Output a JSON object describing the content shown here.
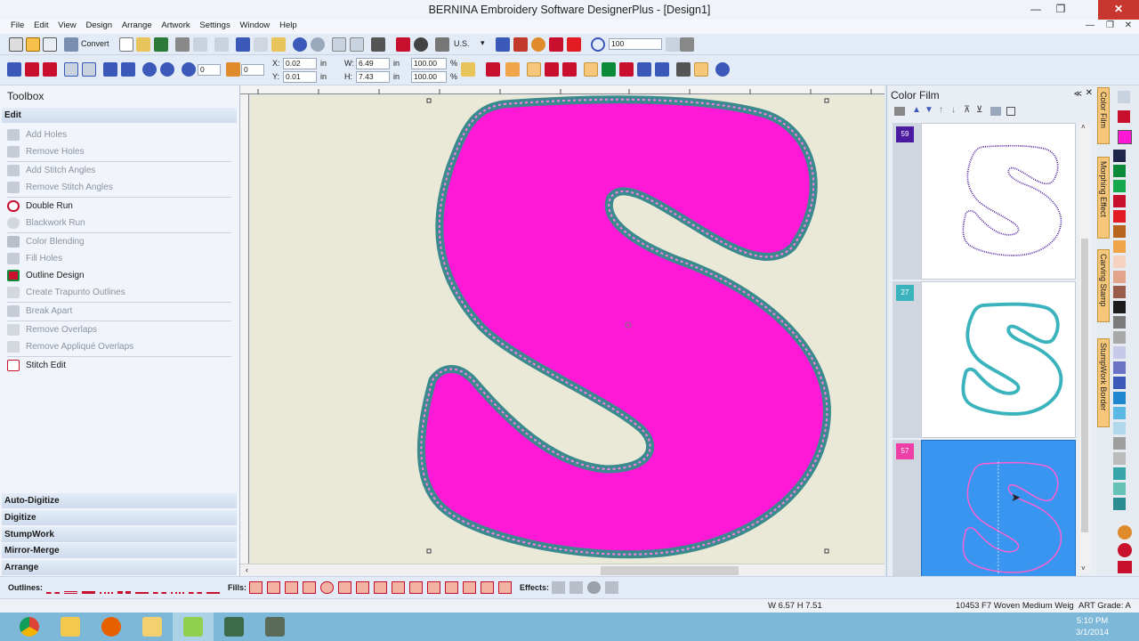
{
  "window": {
    "title": "BERNINA Embroidery Software DesignerPlus - [Design1]"
  },
  "menu": [
    "File",
    "Edit",
    "View",
    "Design",
    "Arrange",
    "Artwork",
    "Settings",
    "Window",
    "Help"
  ],
  "toolbar1": {
    "convert_label": "Convert",
    "units_value": "U.S.",
    "zoom_value": "100"
  },
  "toolbar2": {
    "rotate_value": "0",
    "slant_value": "0",
    "x_label": "X:",
    "x_value": "0.02",
    "y_label": "Y:",
    "y_value": "0.01",
    "w_label": "W:",
    "w_value": "6.49",
    "h_label": "H:",
    "h_value": "7.43",
    "unit": "in",
    "w_pct": "100.00",
    "h_pct": "100.00",
    "pct": "%"
  },
  "toolbox": {
    "title": "Toolbox",
    "edit_header": "Edit",
    "items": [
      {
        "label": "Add Holes",
        "enabled": false
      },
      {
        "label": "Remove Holes",
        "enabled": false
      },
      {
        "label": "Add Stitch Angles",
        "enabled": false
      },
      {
        "label": "Remove Stitch Angles",
        "enabled": false
      },
      {
        "label": "Double Run",
        "enabled": true
      },
      {
        "label": "Blackwork Run",
        "enabled": false
      },
      {
        "label": "Color Blending",
        "enabled": false
      },
      {
        "label": "Fill Holes",
        "enabled": false
      },
      {
        "label": "Outline Design",
        "enabled": true
      },
      {
        "label": "Create Trapunto Outlines",
        "enabled": false
      },
      {
        "label": "Break Apart",
        "enabled": false
      },
      {
        "label": "Remove Overlaps",
        "enabled": false
      },
      {
        "label": "Remove Appliqué Overlaps",
        "enabled": false
      },
      {
        "label": "Stitch Edit",
        "enabled": true
      }
    ],
    "groups": [
      "Auto-Digitize",
      "Digitize",
      "StumpWork",
      "Mirror-Merge",
      "Arrange"
    ]
  },
  "color_film": {
    "title": "Color Film",
    "rows": [
      {
        "number": "59",
        "color": "#4a1aa0"
      },
      {
        "number": "27",
        "color": "#3bb3bd"
      },
      {
        "number": "57",
        "color": "#ee3fa6"
      }
    ]
  },
  "side_tabs": [
    "Color Film",
    "Morphing Effect",
    "Carving Stamp",
    "StumpWork Border"
  ],
  "bottom_toolbar": {
    "outlines_label": "Outlines:",
    "fills_label": "Fills:",
    "effects_label": "Effects:"
  },
  "status": {
    "dimensions": "W 6.57 H 7.51",
    "fabric": "10453  F7 Woven Medium Weig",
    "art_grade": "ART Grade: A"
  },
  "clock": {
    "time": "5:10 PM",
    "date": "3/1/2014"
  },
  "colors": {
    "fill": "#ff18d6",
    "outline": "#3a8a8e",
    "canvas": "#eae8d6"
  },
  "palette": [
    "#20264a",
    "#0b8b3a",
    "#15a84c",
    "#c8102e",
    "#e31b23",
    "#b5651d",
    "#f0a54a",
    "#f6d3c0",
    "#e2a58c",
    "#9a5b4a",
    "#1c1c1c",
    "#7a7a7a",
    "#a9a9a9",
    "#c8c8e8",
    "#6b73c4",
    "#3a59b8",
    "#1f86d0",
    "#5bb7e6",
    "#b0d7ea",
    "#9e9e9e",
    "#bcbcbc",
    "#38a5a8",
    "#66c2b7",
    "#2d8d92"
  ]
}
